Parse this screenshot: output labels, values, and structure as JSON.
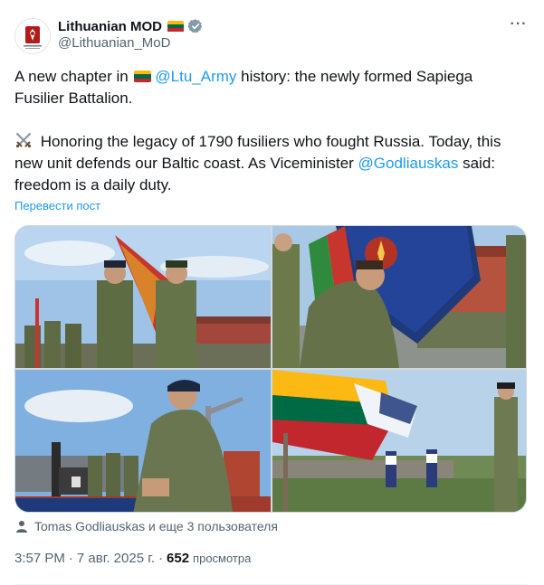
{
  "author": {
    "display_name": "Lithuanian MOD",
    "handle": "@Lithuanian_MoD",
    "flag_icon": "lithuania-flag-icon",
    "verified_icon": "verified-badge-icon"
  },
  "more_menu": "···",
  "post": {
    "p1_pre": "A new chapter in ",
    "p1_link": "@Ltu_Army",
    "p1_post": " history: the newly formed Sapiega Fusilier Battalion.",
    "p2_pre": " Honoring the legacy of 1790 fusiliers who fought Russia. Today, this new unit defends our Baltic coast. As Viceminister ",
    "p2_link": "@Godliauskas",
    "p2_post": " said: freedom is a daily duty.",
    "translate_label": "Перевести пост"
  },
  "media": [
    {
      "icon": "photo-soldiers-flag-handover"
    },
    {
      "icon": "photo-soldier-kissing-banner"
    },
    {
      "icon": "photo-officer-signing-document"
    },
    {
      "icon": "photo-flags-historic-fusiliers"
    }
  ],
  "tagged": "Tomas Godliauskas и еще 3 пользователя",
  "meta": {
    "time": "3:57 PM",
    "sep1": "·",
    "date": "7 авг. 2025 г.",
    "sep2": "·",
    "views_count": "652",
    "views_label": "просмотра"
  },
  "colors": {
    "link": "#1d9bf0",
    "secondary_text": "#536471",
    "primary_text": "#0f1419",
    "lt_yellow": "#FDB913",
    "lt_green": "#006A44",
    "lt_red": "#C1272D"
  }
}
